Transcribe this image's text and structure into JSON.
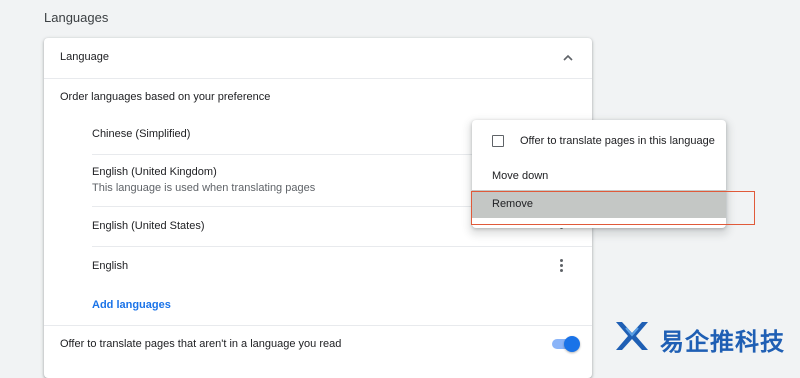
{
  "section": {
    "title": "Languages"
  },
  "card": {
    "header_title": "Language",
    "subtitle": "Order languages based on your preference",
    "languages": [
      {
        "name": "Chinese (Simplified)",
        "note": ""
      },
      {
        "name": "English (United Kingdom)",
        "note": "This language is used when translating pages"
      },
      {
        "name": "English (United States)",
        "note": ""
      },
      {
        "name": "English",
        "note": ""
      }
    ],
    "add_languages_label": "Add languages",
    "offer_translate_label": "Offer to translate pages that aren't in a language you read",
    "offer_translate_enabled": true
  },
  "context_menu": {
    "offer_label": "Offer to translate pages in this language",
    "offer_checked": false,
    "move_down_label": "Move down",
    "remove_label": "Remove"
  },
  "watermark": {
    "text": "易企推科技"
  },
  "colors": {
    "accent": "#1a73e8",
    "highlight_border": "#e05a3a",
    "selected_item_bg": "#c4c7c5"
  },
  "icons": [
    "chevron-up-icon",
    "more-vert-icon",
    "checkbox-icon",
    "brand-logo-icon"
  ]
}
